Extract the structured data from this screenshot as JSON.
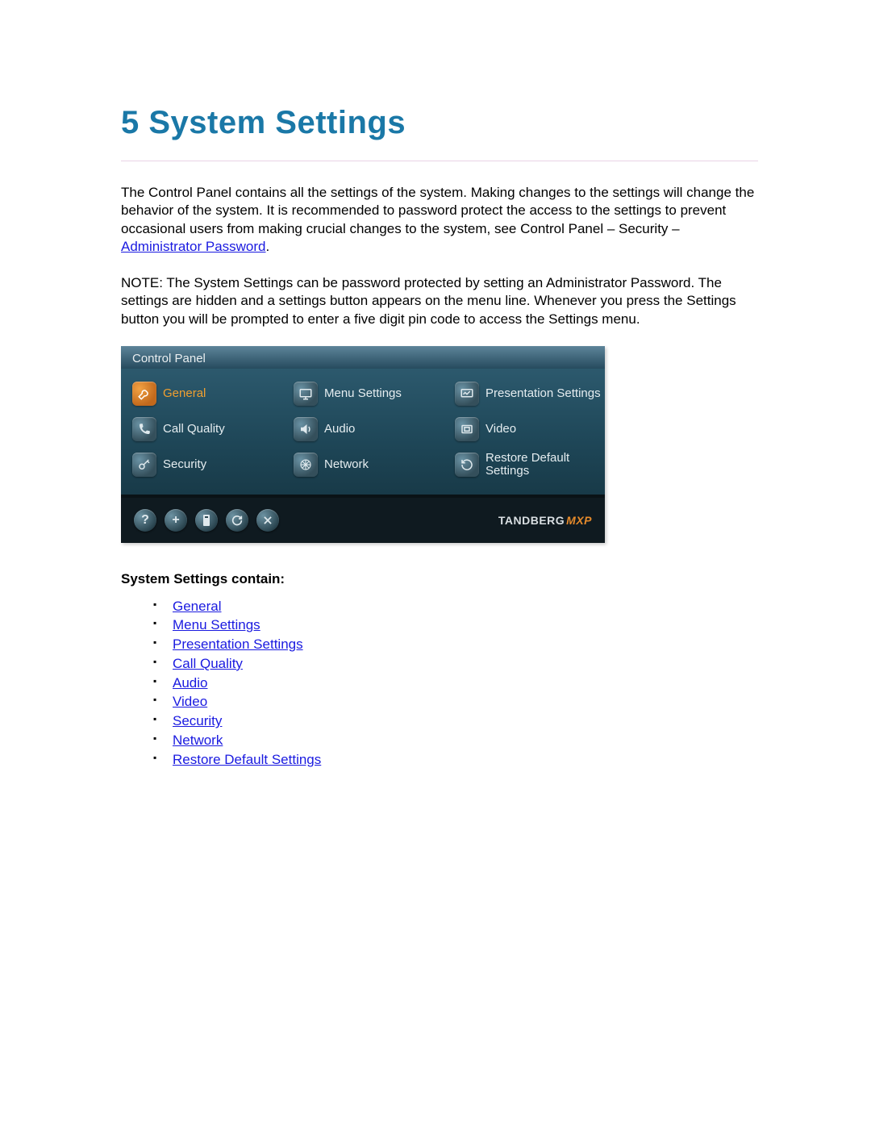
{
  "heading": "5  System Settings",
  "para1_pre": "The Control Panel contains all the settings of the system. Making changes to the settings will change the behavior of the system. It is recommended to password protect the access to the settings to prevent occasional users from making crucial changes to the system, see Control Panel – Security – ",
  "para1_link": "Administrator Password",
  "para1_post": ".",
  "para2": "NOTE: The System Settings can be password protected by setting an Administrator Password. The settings are hidden and a settings button appears on the menu line. Whenever you press the Settings button you will be prompted to enter a five digit pin code to access the Settings menu.",
  "panel": {
    "title": "Control Panel",
    "items": [
      {
        "label": "General",
        "icon": "wrench",
        "selected": true
      },
      {
        "label": "Menu Settings",
        "icon": "monitor"
      },
      {
        "label": "Presentation Settings",
        "icon": "chart"
      },
      {
        "label": "Call Quality",
        "icon": "phone"
      },
      {
        "label": "Audio",
        "icon": "speaker"
      },
      {
        "label": "Video",
        "icon": "frame"
      },
      {
        "label": "Security",
        "icon": "key"
      },
      {
        "label": "Network",
        "icon": "web"
      },
      {
        "label": "Restore Default Settings",
        "icon": "reload"
      }
    ],
    "footer_icons": [
      "help",
      "plus",
      "remote",
      "refresh",
      "close"
    ],
    "brand1": "TANDBERG",
    "brand2": "MXP"
  },
  "list_heading": "System Settings contain:",
  "links": [
    "General",
    "Menu Settings",
    "Presentation Settings",
    "Call Quality",
    "Audio",
    "Video",
    "Security",
    "Network",
    "Restore Default Settings"
  ]
}
